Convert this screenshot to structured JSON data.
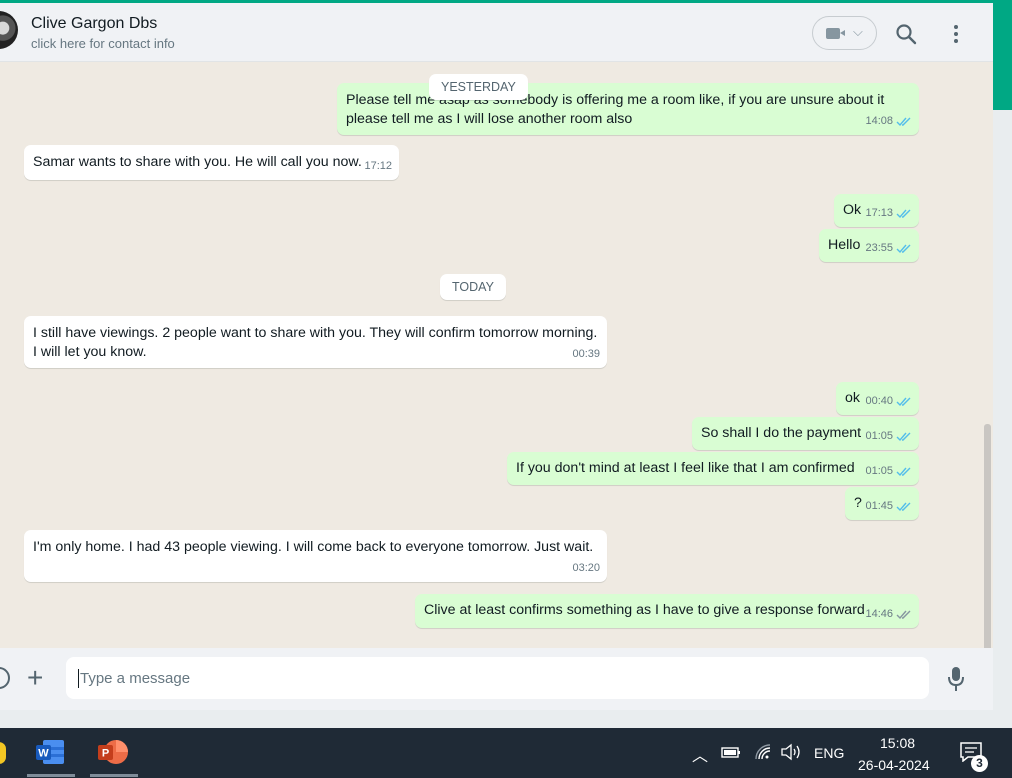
{
  "header": {
    "contact_name": "Clive Gargon Dbs",
    "contact_sub": "click here for contact info"
  },
  "date_chips": {
    "yesterday": "YESTERDAY",
    "today": "TODAY"
  },
  "messages": [
    {
      "dir": "out",
      "text": "Please tell me asap as somebody is offering me a room like, if you are unsure about it please tell me as I will lose another room also",
      "time": "14:08",
      "read": true
    },
    {
      "dir": "in",
      "text": "Samar wants to share with you. He will call you now.",
      "time": "17:12"
    },
    {
      "dir": "out",
      "text": "Ok",
      "time": "17:13",
      "read": true
    },
    {
      "dir": "out",
      "text": "Hello",
      "time": "23:55",
      "read": true
    },
    {
      "dir": "in",
      "text": "I still have viewings. 2 people want to share with you. They will confirm tomorrow morning. I will let you know.",
      "time": "00:39"
    },
    {
      "dir": "out",
      "text": "ok",
      "time": "00:40",
      "read": true
    },
    {
      "dir": "out",
      "text": "So shall I do the payment",
      "time": "01:05",
      "read": true
    },
    {
      "dir": "out",
      "text": "If you don't mind at least I feel like that I am confirmed",
      "time": "01:05",
      "read": true
    },
    {
      "dir": "out",
      "text": "?",
      "time": "01:45",
      "read": true
    },
    {
      "dir": "in",
      "text": "I'm only home. I had 43 people viewing. I will come back to everyone tomorrow. Just wait.",
      "time": "03:20"
    },
    {
      "dir": "out",
      "text": "Clive at least confirms something as I have to give a response forward",
      "time": "14:46",
      "read": false
    }
  ],
  "composer": {
    "placeholder": "Type a message"
  },
  "taskbar": {
    "language": "ENG",
    "time": "15:08",
    "date": "26-04-2024",
    "notifications": "3"
  },
  "colors": {
    "outgoing_bubble": "#d9fdd3",
    "incoming_bubble": "#ffffff",
    "chat_bg": "#efeae2",
    "read_tick": "#53bdeb",
    "unread_tick": "#8696a0",
    "accent": "#00a884"
  },
  "icons": [
    "video-call-icon",
    "search-icon",
    "menu-icon",
    "emoji-icon",
    "plus-icon",
    "mic-icon",
    "word-icon",
    "powerpoint-icon",
    "battery-icon",
    "wifi-icon",
    "volume-icon",
    "notification-icon"
  ]
}
